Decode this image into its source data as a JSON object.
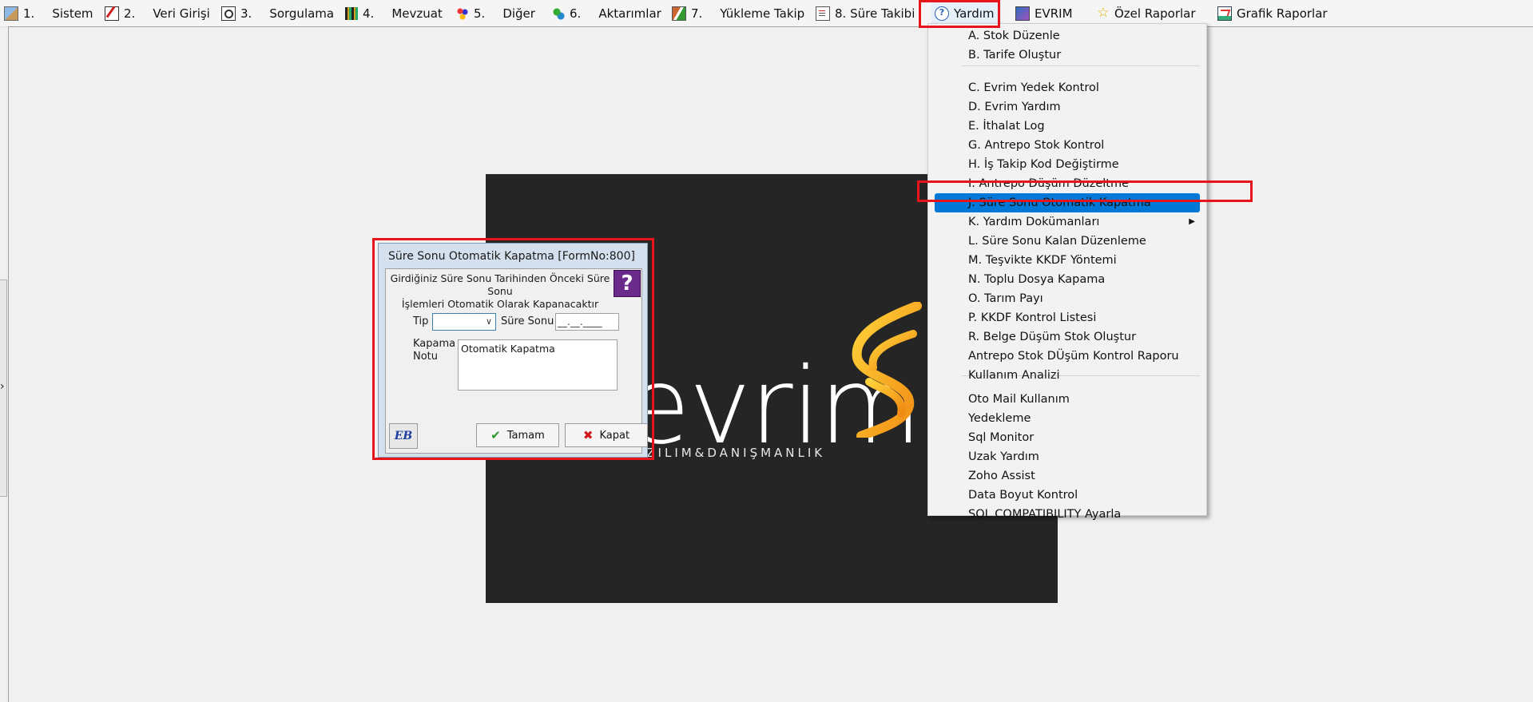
{
  "menubar": {
    "items": [
      {
        "num": "1.",
        "label": "Sistem",
        "icon": "cube-icon"
      },
      {
        "num": "2.",
        "label": "Veri Girişi",
        "icon": "pen-icon"
      },
      {
        "num": "3.",
        "label": "Sorgulama",
        "icon": "magnifier-icon"
      },
      {
        "num": "4.",
        "label": "Mevzuat",
        "icon": "books-icon"
      },
      {
        "num": "5.",
        "label": "Diğer",
        "icon": "people-icon"
      },
      {
        "num": "6.",
        "label": "Aktarımlar",
        "icon": "gears-icon"
      },
      {
        "num": "7.",
        "label": "Yükleme Takip",
        "icon": "truck-icon"
      },
      {
        "num": "",
        "label": "8. Süre Takibi",
        "icon": "clipboard-icon"
      },
      {
        "num": "",
        "label": "Yardım",
        "icon": "help-icon"
      },
      {
        "num": "",
        "label": "EVRIM",
        "icon": "book-icon"
      },
      {
        "num": "",
        "label": "Özel Raporlar",
        "icon": "star-icon"
      },
      {
        "num": "",
        "label": "Grafik Raporlar",
        "icon": "chart-icon"
      }
    ]
  },
  "dropdown": {
    "items": [
      "A.   Stok Düzenle",
      "B.   Tarife Oluştur",
      "C.   Evrim Yedek Kontrol",
      "D.   Evrim Yardım",
      "E.   İthalat Log",
      "G.   Antrepo Stok Kontrol",
      "H.  İş Takip Kod Değiştirme",
      "I.    Antrepo Düşüm Düzeltme",
      "J.   Süre Sonu Otomatik Kapatma",
      "K.   Yardım Dokümanları",
      "L. Süre Sonu Kalan Düzenleme",
      "M. Teşvikte KKDF Yöntemi",
      "N. Toplu Dosya Kapama",
      "O. Tarım Payı",
      "P. KKDF Kontrol Listesi",
      "R. Belge Düşüm Stok Oluştur",
      "Antrepo Stok DÜşüm Kontrol Raporu",
      "Kullanım Analizi",
      "Oto Mail Kullanım",
      "Yedekleme",
      "Sql Monitor",
      "Uzak Yardım",
      "Zoho Assist",
      "Data Boyut Kontrol",
      "SQL COMPATIBILITY Ayarla"
    ],
    "highlighted_index": 8,
    "submenu_index": 9
  },
  "dialog": {
    "title": "Süre Sonu Otomatik Kapatma [FormNo:800]",
    "info_line1": "Girdiğiniz Süre Sonu Tarihinden Önceki Süre Sonu",
    "info_line2": "İşlemleri Otomatik Olarak Kapanacaktır",
    "help_glyph": "?",
    "tip_label": "Tip",
    "tip_value": "",
    "sure_sonu_label": "Süre Sonu",
    "sure_sonu_mask": "__.__.____",
    "kapama_notu_label_line1": "Kapama",
    "kapama_notu_label_line2": "Notu",
    "kapama_notu_value": "Otomatik Kapatma",
    "eb_label": "EB",
    "ok_label": "Tamam",
    "close_label": "Kapat"
  },
  "logo": {
    "word": "evrim",
    "tagline": "YAZILIM&DANIŞMANLIK"
  },
  "colors": {
    "highlight": "#0078d7",
    "annotation_red": "#e8141c",
    "logo_bg": "#252525",
    "logo_accent": "#f5a623"
  }
}
